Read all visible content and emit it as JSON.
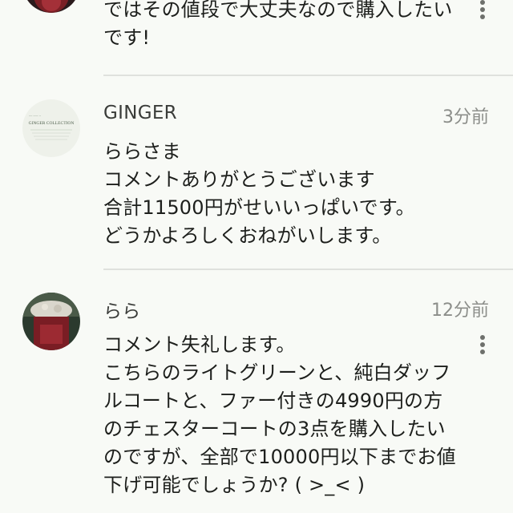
{
  "comments": [
    {
      "body": "ではその値段で大丈夫なので購入したい\nです!"
    },
    {
      "name": "GINGER",
      "time": "3分前",
      "avatar_text": "GINGER COLLECTION",
      "body": "ららさま\nコメントありがとうございます\n合計11500円がせいいっぱいです。\nどうかよろしくおねがいします。"
    },
    {
      "name": "らら",
      "time": "12分前",
      "body": "コメント失礼します。\nこちらのライトグリーンと、純白ダッフ\nルコートと、ファー付きの4990円の方\nのチェスターコートの3点を購入したい\nのですが、全部で10000円以下までお値\n下げ可能でしょうか? ( >_< )"
    }
  ],
  "icons": {
    "more": "more-vertical-icon"
  },
  "colors": {
    "background": "#f8faf6",
    "divider": "#dfe1dd",
    "timestamp": "#8c8e8a"
  }
}
